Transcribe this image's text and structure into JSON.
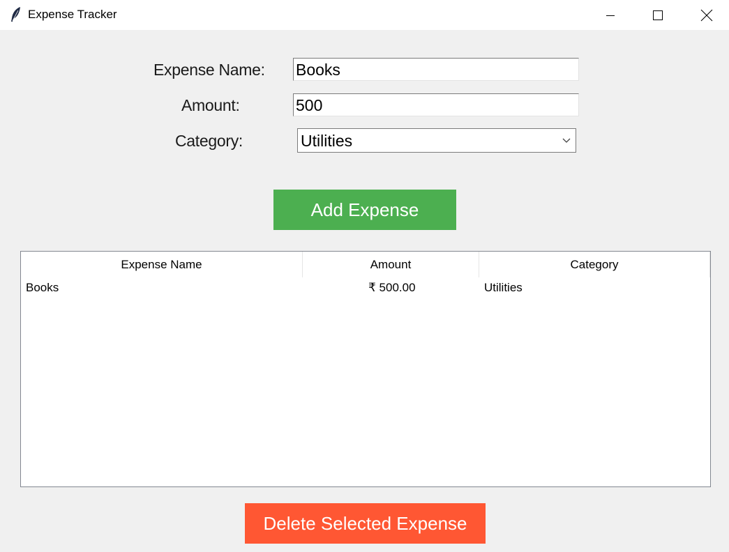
{
  "window": {
    "title": "Expense Tracker",
    "icon": "feather-icon",
    "controls": [
      "minimize-icon",
      "maximize-icon",
      "close-icon"
    ]
  },
  "form": {
    "name_label": "Expense Name:",
    "name_value": "Books",
    "amount_label": "Amount:",
    "amount_value": "500",
    "category_label": "Category:",
    "category_value": "Utilities"
  },
  "buttons": {
    "add_label": "Add Expense",
    "add_color": "#4caf50",
    "delete_label": "Delete Selected Expense",
    "delete_color": "#ff5733"
  },
  "table": {
    "columns": [
      "Expense Name",
      "Amount",
      "Category"
    ],
    "rows": [
      {
        "name": "Books",
        "amount": "₹ 500.00",
        "category": "Utilities"
      }
    ]
  }
}
